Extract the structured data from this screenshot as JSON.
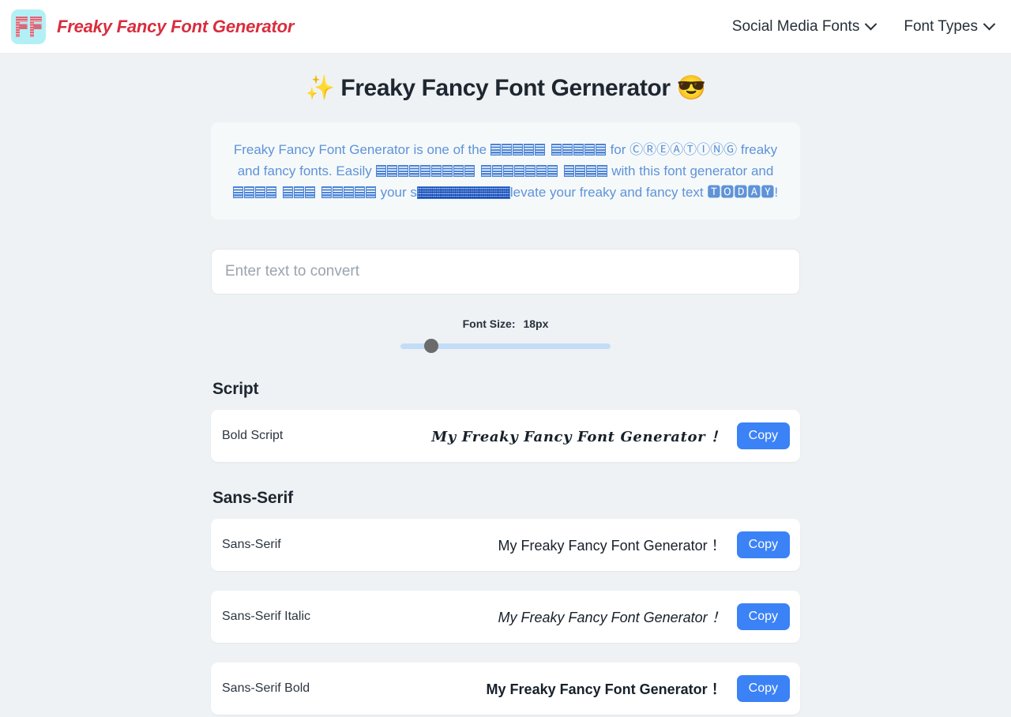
{
  "header": {
    "brand_name": "Freaky Fancy Font Generator",
    "logo_letters": "FF",
    "nav": [
      {
        "label": "Social Media Fonts",
        "icon": "chevron-down-icon"
      },
      {
        "label": "Font Types",
        "icon": "chevron-down-icon"
      }
    ]
  },
  "main": {
    "page_title": "✨ Freaky Fancy Font Gernerator 😎",
    "intro": {
      "seg1": "Freaky Fancy Font Generator is one of the ",
      "seg2": " for ",
      "circled_creating": "ⒸⓇⒺⒶⓉⒾⓃⒼ",
      "seg3": " freaky and fancy fonts. Easily ",
      "seg4": " with this font generator and ",
      "seg5": " your s",
      "seg6": "levate your freaky and fancy text ",
      "boxed_today": "🆃🅾🅳🅰🆈",
      "seg7": "!"
    },
    "input": {
      "value": "",
      "placeholder": "Enter text to convert"
    },
    "font_size": {
      "label": "Font Size:",
      "value": "18px",
      "slider_percent": 12
    },
    "sections": [
      {
        "title": "Script",
        "rows": [
          {
            "name": "Bold Script",
            "sample": "𝓜𝔂 𝓕𝓻𝓮𝓪𝓴𝔂 𝓕𝓪𝓷𝓬𝔂 𝓕𝓸𝓷𝓽 𝓖𝓮𝓷𝓮𝓻𝓪𝓽𝓸𝓻 ！",
            "sample_plain": "My Freaky Fancy Font Generator ！",
            "copy_label": "Copy",
            "style": "script"
          }
        ]
      },
      {
        "title": "Sans-Serif",
        "rows": [
          {
            "name": "Sans-Serif",
            "sample": "My Freaky Fancy Font Generator ！",
            "sample_plain": "My Freaky Fancy Font Generator ！",
            "copy_label": "Copy",
            "style": "plain"
          },
          {
            "name": "Sans-Serif Italic",
            "sample": "𝘔𝘺 𝘍𝘳𝘦𝘢𝘬𝘺 𝘍𝘢𝘯𝘤𝘺 𝘍𝘰𝘯𝘵 𝘎𝘦𝘯𝘦𝘳𝘢𝘵𝘰𝘳 ！",
            "sample_plain": "My Freaky Fancy Font Generator ！",
            "copy_label": "Copy",
            "style": "italic"
          },
          {
            "name": "Sans-Serif Bold",
            "sample": "𝗠𝘆 𝗙𝗿𝗲𝗮𝗸𝘆 𝗙𝗮𝗻𝗰𝘆 𝗙𝗼𝗻𝘁 𝗚𝗲𝗻𝗲𝗿𝗮𝘁𝗼𝗿 ！",
            "sample_plain": "My Freaky Fancy Font Generator ！",
            "copy_label": "Copy",
            "style": "bold"
          }
        ]
      }
    ]
  },
  "colors": {
    "brand_red": "#d92d3e",
    "logo_bg": "#b3f0f5",
    "accent_blue": "#3b82f6",
    "intro_text": "#5e93d8",
    "page_bg": "#eef2f4",
    "slider_track": "#c3dcf7",
    "slider_thumb": "#6b6b6b"
  }
}
